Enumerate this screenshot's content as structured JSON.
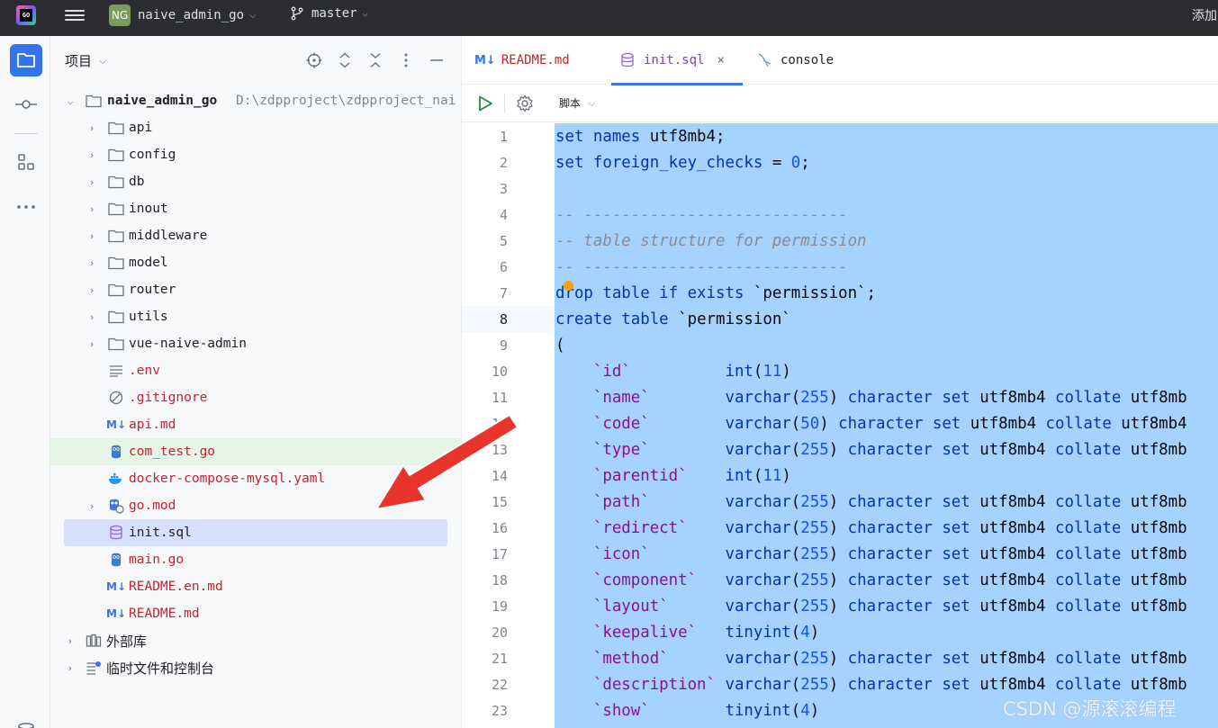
{
  "titlebar": {
    "logo_text": "GO",
    "project_badge": "NG",
    "project_name": "naive_admin_go",
    "branch": "master",
    "right_text": "添加"
  },
  "toolstrip": {
    "items": [
      "project-icon",
      "commit-icon",
      "structure-icon",
      "more-icon",
      "database-icon"
    ]
  },
  "project_panel": {
    "title": "项目",
    "root": {
      "name": "naive_admin_go",
      "path": "D:\\zdpproject\\zdpproject_nai"
    },
    "items": [
      {
        "label": "api",
        "type": "folder"
      },
      {
        "label": "config",
        "type": "folder"
      },
      {
        "label": "db",
        "type": "folder"
      },
      {
        "label": "inout",
        "type": "folder"
      },
      {
        "label": "middleware",
        "type": "folder"
      },
      {
        "label": "model",
        "type": "folder"
      },
      {
        "label": "router",
        "type": "folder"
      },
      {
        "label": "utils",
        "type": "folder"
      },
      {
        "label": "vue-naive-admin",
        "type": "folder"
      },
      {
        "label": ".env",
        "type": "text"
      },
      {
        "label": ".gitignore",
        "type": "ignore"
      },
      {
        "label": "api.md",
        "type": "markdown"
      },
      {
        "label": "com_test.go",
        "type": "go"
      },
      {
        "label": "docker-compose-mysql.yaml",
        "type": "docker"
      },
      {
        "label": "go.mod",
        "type": "gomod"
      },
      {
        "label": "init.sql",
        "type": "sql"
      },
      {
        "label": "main.go",
        "type": "go"
      },
      {
        "label": "README.en.md",
        "type": "markdown"
      },
      {
        "label": "README.md",
        "type": "markdown"
      }
    ],
    "external_libs": "外部库",
    "scratches": "临时文件和控制台"
  },
  "editor": {
    "tabs": [
      {
        "label": "README.md",
        "icon": "M↓"
      },
      {
        "label": "init.sql",
        "icon": "database-icon",
        "close": "×"
      },
      {
        "label": "console",
        "icon": "console-icon"
      }
    ],
    "toolbar": {
      "script_label": "脚本"
    },
    "line_numbers": [
      "1",
      "2",
      "3",
      "4",
      "5",
      "6",
      "7",
      "8",
      "9",
      "10",
      "11",
      "12",
      "13",
      "14",
      "15",
      "16",
      "17",
      "18",
      "19",
      "20",
      "21",
      "22",
      "23"
    ],
    "current_line": "8"
  },
  "code": {
    "l1": {
      "a": "set names ",
      "b": "utf8mb4",
      "c": ";"
    },
    "l2": {
      "a": "set foreign_key_checks ",
      "b": "= ",
      "c": "0",
      "d": ";"
    },
    "l4": "-- ----------------------------",
    "l5": "-- table structure for permission",
    "l6": "-- ----------------------------",
    "l7": {
      "a": "drop table if exists ",
      "b": "`permission`",
      "c": ";"
    },
    "l8": {
      "a": "create table ",
      "b": "`permission`"
    },
    "l9": "(",
    "columns": [
      {
        "name": "`id`",
        "type": "int",
        "size": "11",
        "rest": ")"
      },
      {
        "name": "`name`",
        "type": "varchar",
        "size": "255",
        "rest": ") character set utf8mb4 collate utf8mb"
      },
      {
        "name": "`code`",
        "type": "varchar",
        "size": "50",
        "rest": ") character set utf8mb4 collate utf8mb4"
      },
      {
        "name": "`type`",
        "type": "varchar",
        "size": "255",
        "rest": ") character set utf8mb4 collate utf8mb"
      },
      {
        "name": "`parentid`",
        "type": "int",
        "size": "11",
        "rest": ")"
      },
      {
        "name": "`path`",
        "type": "varchar",
        "size": "255",
        "rest": ") character set utf8mb4 collate utf8mb"
      },
      {
        "name": "`redirect`",
        "type": "varchar",
        "size": "255",
        "rest": ") character set utf8mb4 collate utf8mb"
      },
      {
        "name": "`icon`",
        "type": "varchar",
        "size": "255",
        "rest": ") character set utf8mb4 collate utf8mb"
      },
      {
        "name": "`component`",
        "type": "varchar",
        "size": "255",
        "rest": ") character set utf8mb4 collate utf8mb"
      },
      {
        "name": "`layout`",
        "type": "varchar",
        "size": "255",
        "rest": ") character set utf8mb4 collate utf8mb"
      },
      {
        "name": "`keepalive`",
        "type": "tinyint",
        "size": "4",
        "rest": ")"
      },
      {
        "name": "`method`",
        "type": "varchar",
        "size": "255",
        "rest": ") character set utf8mb4 collate utf8mb"
      },
      {
        "name": "`description`",
        "type": "varchar",
        "size": "255",
        "rest": ") character set utf8mb4 collate utf8mb"
      },
      {
        "name": "`show`",
        "type": "tinyint",
        "size": "4",
        "rest": ")"
      }
    ]
  },
  "watermark": "CSDN @源滚滚编程",
  "colors": {
    "accent": "#3574f0",
    "selection": "#a6d2ff",
    "annotation": "#e8342b"
  }
}
